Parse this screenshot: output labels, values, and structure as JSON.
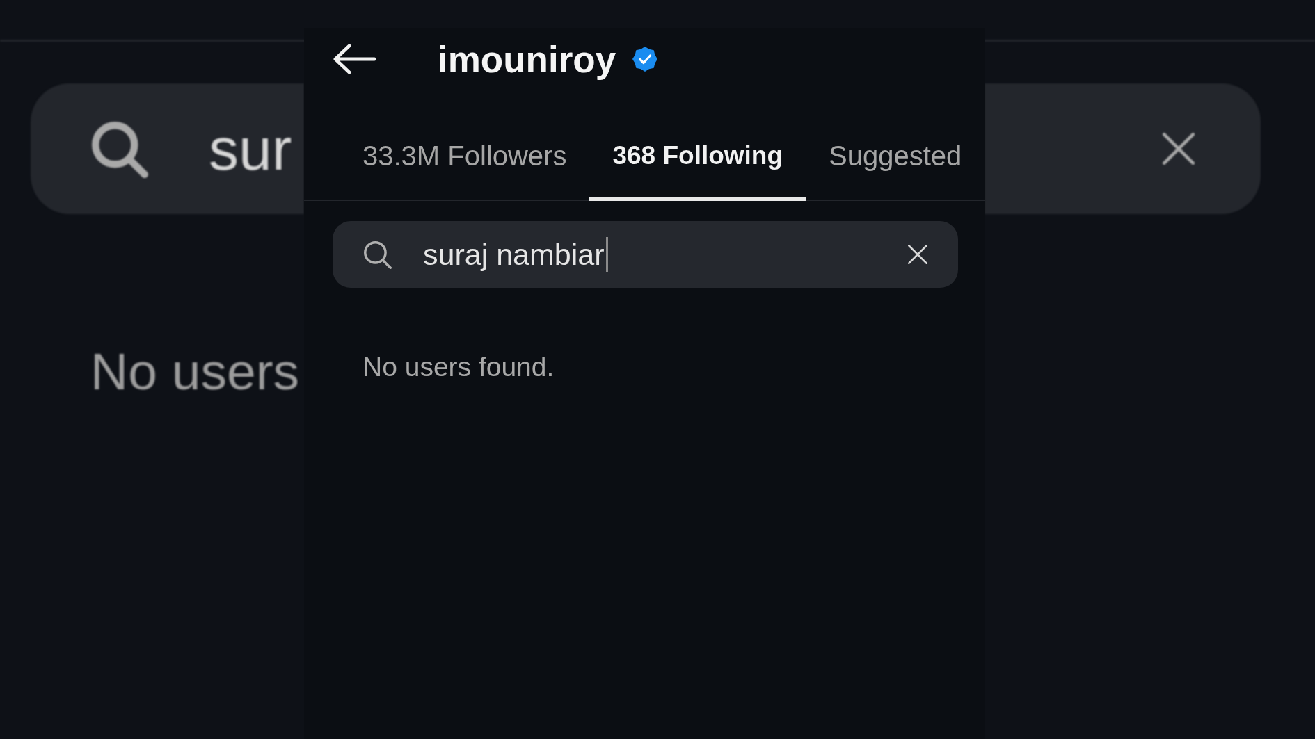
{
  "backdrop": {
    "search": {
      "value": "sur"
    },
    "message": "No users"
  },
  "header": {
    "title": "imouniroy",
    "verified": true
  },
  "tabs": [
    {
      "label": "33.3M Followers",
      "selected": false
    },
    {
      "label": "368 Following",
      "selected": true
    },
    {
      "label": "Suggested",
      "selected": false
    }
  ],
  "search": {
    "value": "suraj nambiar",
    "focused": true
  },
  "message": "No users found."
}
